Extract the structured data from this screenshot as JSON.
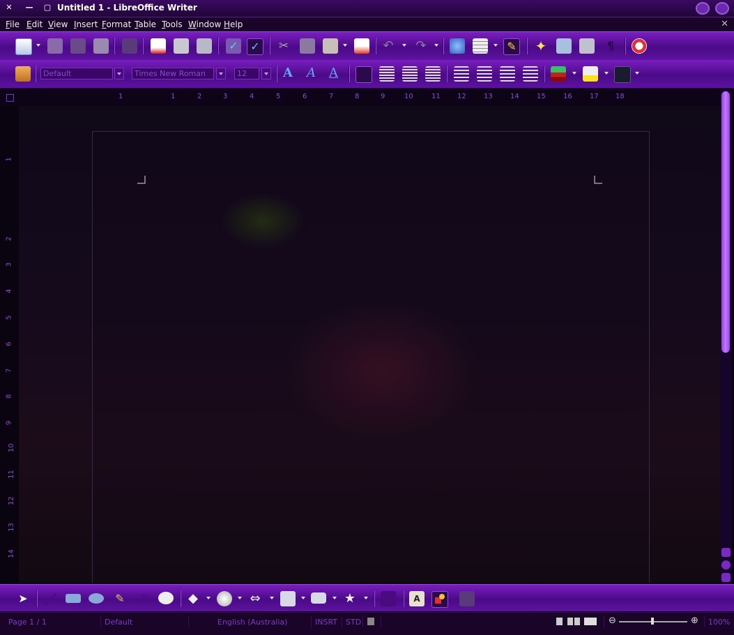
{
  "window": {
    "title": "Untitled 1 - LibreOffice Writer",
    "close_glyph": "✕",
    "min_glyph": "—",
    "max_glyph": "▢",
    "doc_close_glyph": "✕"
  },
  "menu": {
    "items": [
      {
        "key": "F",
        "rest": "ile"
      },
      {
        "key": "E",
        "rest": "dit"
      },
      {
        "key": "V",
        "rest": "iew"
      },
      {
        "key": "I",
        "rest": "nsert"
      },
      {
        "key": "F",
        "rest": "ormat"
      },
      {
        "key": "T",
        "rest": "able"
      },
      {
        "key": "T",
        "rest": "ools"
      },
      {
        "key": "W",
        "rest": "indow"
      },
      {
        "key": "H",
        "rest": "elp"
      }
    ]
  },
  "formatting": {
    "style": "Default",
    "font": "Times New Roman",
    "size": "12",
    "letter_a": "A"
  },
  "ruler": {
    "h_labels": [
      "1",
      "1",
      "2",
      "3",
      "4",
      "5",
      "6",
      "7",
      "8",
      "9",
      "10",
      "11",
      "12",
      "13",
      "14",
      "15",
      "16",
      "17",
      "18"
    ],
    "v_labels": [
      "1",
      "2",
      "3",
      "4",
      "5",
      "6",
      "7",
      "8",
      "9",
      "10",
      "11",
      "12",
      "13",
      "14"
    ]
  },
  "status": {
    "page": "Page 1 / 1",
    "style": "Default",
    "language": "English (Australia)",
    "insert_mode": "INSRT",
    "selection_mode": "STD",
    "zoom": "100%"
  },
  "colors": {
    "accent": "#7a1ec0",
    "menu_bg": "#1a0428",
    "status_text": "#7a3ac8"
  }
}
